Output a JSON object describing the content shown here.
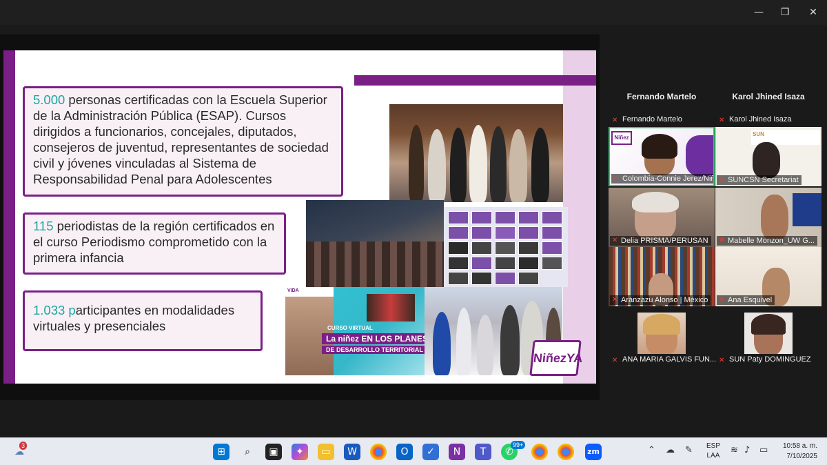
{
  "window": {
    "minimize": "—",
    "maximize": "❐",
    "close": "✕"
  },
  "slide": {
    "box1": {
      "num": "5.000",
      "text": " personas certificadas con la Escuela Superior de la Administración Pública (ESAP). Cursos dirigidos a funcionarios, concejales, diputados, consejeros de juventud, representantes de sociedad civil y jóvenes vinculadas al Sistema de Responsabilidad Penal para Adolescentes"
    },
    "box2": {
      "num": "115",
      "text": " periodistas de la región certificados en el curso Periodismo comprometido con la primera infancia"
    },
    "box3": {
      "num": "1.033 p",
      "text": "articipantes en modalidades virtuales y presenciales"
    },
    "poster": {
      "tag": "CURSO VIRTUAL",
      "title": "La niñez EN LOS PLANES",
      "subtitle": "DE DESARROLLO TERRITORIAL",
      "brand": "VIDA"
    },
    "logo": "NiñezYA",
    "accent": "#7a1f86",
    "number_color": "#1aa6a6"
  },
  "participants": {
    "headers": [
      "Fernando Martelo",
      "Karol Jhined Isaza"
    ],
    "labels": [
      "Fernando Martelo",
      "Karol Jhined Isaza"
    ],
    "tiles": [
      "Colombia-Connie Jerez/Niñ...",
      "SUNCSN Secretariat",
      "Delia PRISMA/PERUSAN",
      "Mabelle Monzon_UW G...",
      "Aránzazu Alonso | México",
      "Ana Esquivel",
      "ANA MARIA GALVIS FUN...",
      "SUN Paty DOMINGUEZ"
    ],
    "muted_icon": "mic-muted-icon"
  },
  "taskbar": {
    "weather_badge": "3",
    "whatsapp_badge": "99+",
    "lang": "ESP",
    "lang2": "LAA",
    "time": "10:58 a. m.",
    "date": "7/10/2025",
    "zoom_label": "zm"
  }
}
